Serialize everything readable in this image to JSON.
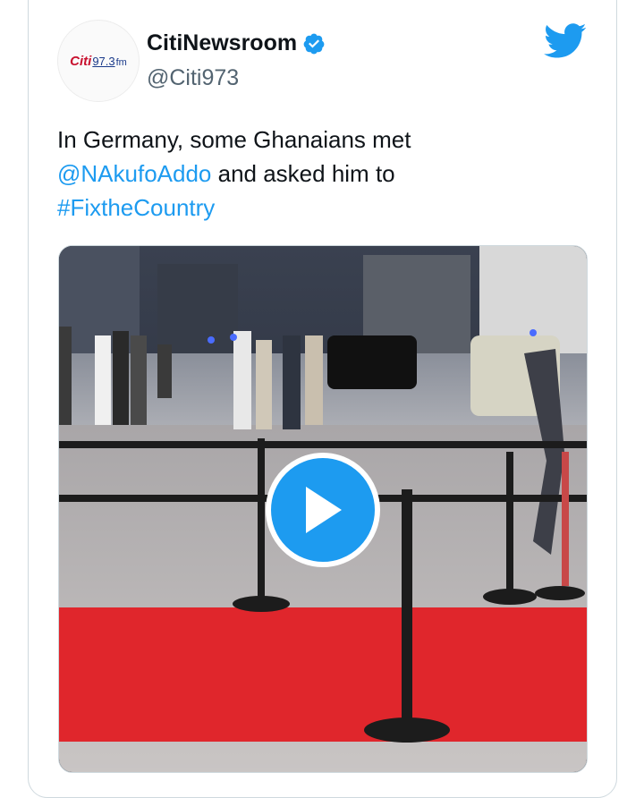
{
  "account": {
    "display_name": "CitiNewsroom",
    "handle": "@Citi973",
    "verified_icon": "verified-badge-icon",
    "avatar_logo": {
      "brand": "Citi",
      "frequency": "97.3",
      "unit": "fm"
    }
  },
  "tweet": {
    "line1": "In Germany, some Ghanaians met",
    "mention": "@NAkufoAddo",
    "line2_rest": " and asked him to",
    "hashtag": "#FixtheCountry"
  },
  "media": {
    "type": "video",
    "play_icon": "play-icon"
  },
  "colors": {
    "twitter_blue": "#1d9bf0",
    "text": "#0f1419",
    "secondary_text": "#536471",
    "red_carpet": "#e0262c"
  },
  "icons": {
    "brand": "twitter-bird-icon"
  }
}
